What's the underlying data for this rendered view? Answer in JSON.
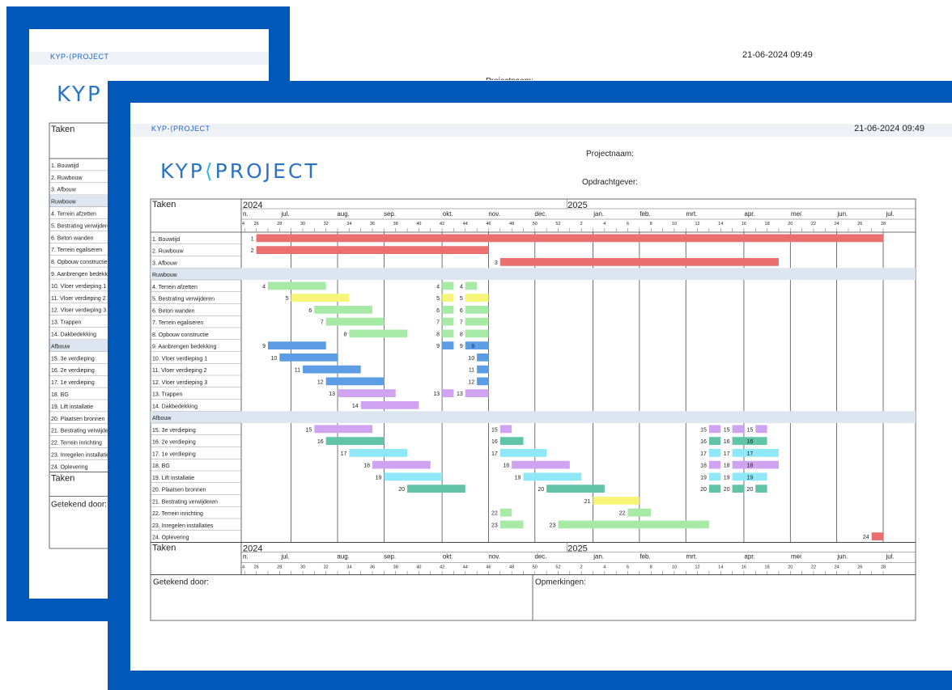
{
  "back_sheet": {
    "brand": "KYP-⟨PROJECT",
    "timestamp": "21-06-2024 09:49",
    "logo_text": "KYP",
    "project_label_partial": "Projectnaam:",
    "header_taken": "Taken",
    "tasks": [
      "1. Bouwtijd",
      "2. Ruwbouw",
      "3. Afbouw",
      "Ruwbouw",
      "4. Terrein afzetten",
      "5. Bestrating verwijderen",
      "6. Beton wanden",
      "7. Terrein egaliseren",
      "8. Opbouw constructie",
      "9. Aanbrengen bedekking",
      "10. Vloer verdieping 1",
      "11. Vloer verdieping 2",
      "12. Vloer verdieping 3",
      "13. Trappen",
      "14. Dakbedekking",
      "Afbouw",
      "15. 3e verdieping",
      "16. 2e verdieping",
      "17. 1e verdieping",
      "18. BG",
      "19. Lift installatie",
      "20. Plaatsen bronnen",
      "21. Bestrating verwijderen",
      "22. Terrein inrichting",
      "23. Inregelen installaties",
      "24. Oplevering"
    ],
    "footer_taken": "Taken",
    "signed_label": "Getekend door:"
  },
  "front_sheet": {
    "brand": "KYP-⟨PROJECT",
    "timestamp": "21-06-2024 09:49",
    "logo_left": "KYP",
    "logo_mid": "⟨",
    "logo_right": "PROJECT",
    "project_label": "Projectnaam:",
    "client_label": "Opdrachtgever:",
    "header_taken": "Taken",
    "footer_taken": "Taken",
    "years": [
      "2024",
      "2025"
    ],
    "months": [
      "n.",
      "jul.",
      "aug.",
      "sep.",
      "okt.",
      "nov.",
      "dec.",
      "jan.",
      "feb.",
      "mrt.",
      "apr.",
      "mei",
      "jun.",
      "jul."
    ],
    "weeks": [
      "4",
      "26",
      "28",
      "30",
      "32",
      "34",
      "36",
      "38",
      "40",
      "42",
      "44",
      "46",
      "48",
      "50",
      "52",
      "2",
      "4",
      "6",
      "8",
      "10",
      "12",
      "14",
      "16",
      "18",
      "20",
      "22",
      "24",
      "26",
      "28"
    ],
    "signed_label": "Getekend door:",
    "remarks_label": "Opmerkingen:"
  },
  "colors": {
    "frame": "#0059b8",
    "red": "#ea6f6f",
    "green": "#a6eaa6",
    "yellow": "#f6f577",
    "blue": "#5d9de6",
    "purple": "#cfa3ef",
    "teal": "#62c4a6",
    "cyan": "#8ee8f8",
    "group_band": "#dde6f0"
  },
  "chart_data": {
    "type": "gantt",
    "x_unit": "week",
    "x_range": [
      25,
      29
    ],
    "rows": [
      {
        "label": "1. Bouwtijd",
        "bars": [
          {
            "n": "1",
            "start": 26,
            "end": 80,
            "color": "red"
          }
        ]
      },
      {
        "label": "2. Ruwbouw",
        "bars": [
          {
            "n": "2",
            "start": 26,
            "end": 46,
            "color": "red"
          }
        ]
      },
      {
        "label": "3. Afbouw",
        "bars": [
          {
            "n": "3",
            "start": 47,
            "end": 71,
            "color": "red"
          }
        ]
      },
      {
        "label": "Ruwbouw",
        "group": true,
        "bars": []
      },
      {
        "label": "4. Terrein afzetten",
        "bars": [
          {
            "n": "4",
            "start": 27,
            "end": 32,
            "color": "green"
          },
          {
            "n": "4",
            "start": 42,
            "end": 43,
            "color": "green"
          },
          {
            "n": "4",
            "start": 44,
            "end": 45,
            "color": "green"
          }
        ]
      },
      {
        "label": "5. Bestrating verwijderen",
        "bars": [
          {
            "n": "5",
            "start": 29,
            "end": 34,
            "color": "yellow"
          },
          {
            "n": "5",
            "start": 42,
            "end": 43,
            "color": "yellow"
          },
          {
            "n": "5",
            "start": 44,
            "end": 46,
            "color": "yellow"
          }
        ]
      },
      {
        "label": "6. Beton wanden",
        "bars": [
          {
            "n": "6",
            "start": 31,
            "end": 36,
            "color": "green"
          },
          {
            "n": "6",
            "start": 42,
            "end": 43,
            "color": "green"
          },
          {
            "n": "6",
            "start": 44,
            "end": 46,
            "color": "green"
          }
        ]
      },
      {
        "label": "7. Terrein egaliseren",
        "bars": [
          {
            "n": "7",
            "start": 32,
            "end": 37,
            "color": "green"
          },
          {
            "n": "7",
            "start": 42,
            "end": 43,
            "color": "green"
          },
          {
            "n": "7",
            "start": 44,
            "end": 46,
            "color": "green"
          }
        ]
      },
      {
        "label": "8. Opbouw constructie",
        "bars": [
          {
            "n": "8",
            "start": 34,
            "end": 39,
            "color": "green"
          },
          {
            "n": "8",
            "start": 42,
            "end": 43,
            "color": "green"
          },
          {
            "n": "8",
            "start": 44,
            "end": 46,
            "color": "green"
          }
        ]
      },
      {
        "label": "9. Aanbrengen bedekking",
        "bars": [
          {
            "n": "9",
            "start": 27,
            "end": 32,
            "color": "blue"
          },
          {
            "n": "9",
            "start": 42,
            "end": 43,
            "color": "blue"
          },
          {
            "n": "9",
            "start": 44,
            "end": 45,
            "color": "blue"
          },
          {
            "n": "9",
            "start": 45,
            "end": 46,
            "color": "blue"
          }
        ]
      },
      {
        "label": "10. Vloer verdieping 1",
        "bars": [
          {
            "n": "10",
            "start": 28,
            "end": 33,
            "color": "blue"
          },
          {
            "n": "10",
            "start": 45,
            "end": 46,
            "color": "blue"
          }
        ]
      },
      {
        "label": "11. Vloer verdieping 2",
        "bars": [
          {
            "n": "11",
            "start": 30,
            "end": 35,
            "color": "blue"
          },
          {
            "n": "11",
            "start": 45,
            "end": 46,
            "color": "blue"
          }
        ]
      },
      {
        "label": "12. Vloer verdieping 3",
        "bars": [
          {
            "n": "12",
            "start": 32,
            "end": 37,
            "color": "blue"
          },
          {
            "n": "12",
            "start": 45,
            "end": 46,
            "color": "blue"
          }
        ]
      },
      {
        "label": "13. Trappen",
        "bars": [
          {
            "n": "13",
            "start": 33,
            "end": 38,
            "color": "purple"
          },
          {
            "n": "13",
            "start": 42,
            "end": 43,
            "color": "purple"
          },
          {
            "n": "13",
            "start": 44,
            "end": 46,
            "color": "purple"
          }
        ]
      },
      {
        "label": "14. Dakbedekking",
        "bars": [
          {
            "n": "14",
            "start": 35,
            "end": 40,
            "color": "purple"
          }
        ]
      },
      {
        "label": "Afbouw",
        "group": true,
        "bars": []
      },
      {
        "label": "15. 3e verdieping",
        "bars": [
          {
            "n": "15",
            "start": 31,
            "end": 36,
            "color": "purple"
          },
          {
            "n": "15",
            "start": 47,
            "end": 48,
            "color": "purple"
          },
          {
            "n": "15",
            "start": 65,
            "end": 66,
            "color": "purple"
          },
          {
            "n": "15",
            "start": 67,
            "end": 68,
            "color": "purple"
          },
          {
            "n": "15",
            "start": 69,
            "end": 70,
            "color": "purple"
          }
        ]
      },
      {
        "label": "16. 2e verdieping",
        "bars": [
          {
            "n": "16",
            "start": 32,
            "end": 37,
            "color": "teal"
          },
          {
            "n": "16",
            "start": 47,
            "end": 49,
            "color": "teal"
          },
          {
            "n": "16",
            "start": 65,
            "end": 66,
            "color": "teal"
          },
          {
            "n": "16",
            "start": 67,
            "end": 69,
            "color": "teal"
          },
          {
            "n": "16",
            "start": 69,
            "end": 70,
            "color": "teal"
          }
        ]
      },
      {
        "label": "17. 1e verdieping",
        "bars": [
          {
            "n": "17",
            "start": 34,
            "end": 39,
            "color": "cyan"
          },
          {
            "n": "17",
            "start": 47,
            "end": 51,
            "color": "cyan"
          },
          {
            "n": "17",
            "start": 65,
            "end": 66,
            "color": "cyan"
          },
          {
            "n": "17",
            "start": 67,
            "end": 69,
            "color": "cyan"
          },
          {
            "n": "17",
            "start": 69,
            "end": 71,
            "color": "cyan"
          }
        ]
      },
      {
        "label": "18. BG",
        "bars": [
          {
            "n": "18",
            "start": 36,
            "end": 41,
            "color": "purple"
          },
          {
            "n": "18",
            "start": 48,
            "end": 53,
            "color": "purple"
          },
          {
            "n": "18",
            "start": 65,
            "end": 66,
            "color": "purple"
          },
          {
            "n": "18",
            "start": 67,
            "end": 69,
            "color": "purple"
          },
          {
            "n": "18",
            "start": 69,
            "end": 71,
            "color": "purple"
          }
        ]
      },
      {
        "label": "19. Lift installatie",
        "bars": [
          {
            "n": "19",
            "start": 37,
            "end": 42,
            "color": "cyan"
          },
          {
            "n": "19",
            "start": 49,
            "end": 54,
            "color": "cyan"
          },
          {
            "n": "19",
            "start": 65,
            "end": 66,
            "color": "cyan"
          },
          {
            "n": "19",
            "start": 67,
            "end": 69,
            "color": "cyan"
          },
          {
            "n": "19",
            "start": 69,
            "end": 70,
            "color": "cyan"
          }
        ]
      },
      {
        "label": "20. Plaatsen bronnen",
        "bars": [
          {
            "n": "20",
            "start": 39,
            "end": 44,
            "color": "teal"
          },
          {
            "n": "20",
            "start": 51,
            "end": 56,
            "color": "teal"
          },
          {
            "n": "20",
            "start": 65,
            "end": 66,
            "color": "teal"
          },
          {
            "n": "20",
            "start": 67,
            "end": 68,
            "color": "teal"
          },
          {
            "n": "20",
            "start": 69,
            "end": 70,
            "color": "teal"
          }
        ]
      },
      {
        "label": "21. Bestrating verwijderen",
        "bars": [
          {
            "n": "21",
            "start": 55,
            "end": 59,
            "color": "yellow"
          }
        ]
      },
      {
        "label": "22. Terrein inrichting",
        "bars": [
          {
            "n": "22",
            "start": 47,
            "end": 48,
            "color": "green"
          },
          {
            "n": "22",
            "start": 58,
            "end": 60,
            "color": "green"
          }
        ]
      },
      {
        "label": "23. Inregelen installaties",
        "bars": [
          {
            "n": "23",
            "start": 47,
            "end": 49,
            "color": "green"
          },
          {
            "n": "23",
            "start": 52,
            "end": 65,
            "color": "green"
          }
        ]
      },
      {
        "label": "24. Oplevering",
        "bars": [
          {
            "n": "24",
            "start": 79,
            "end": 80,
            "color": "red"
          }
        ]
      }
    ]
  }
}
